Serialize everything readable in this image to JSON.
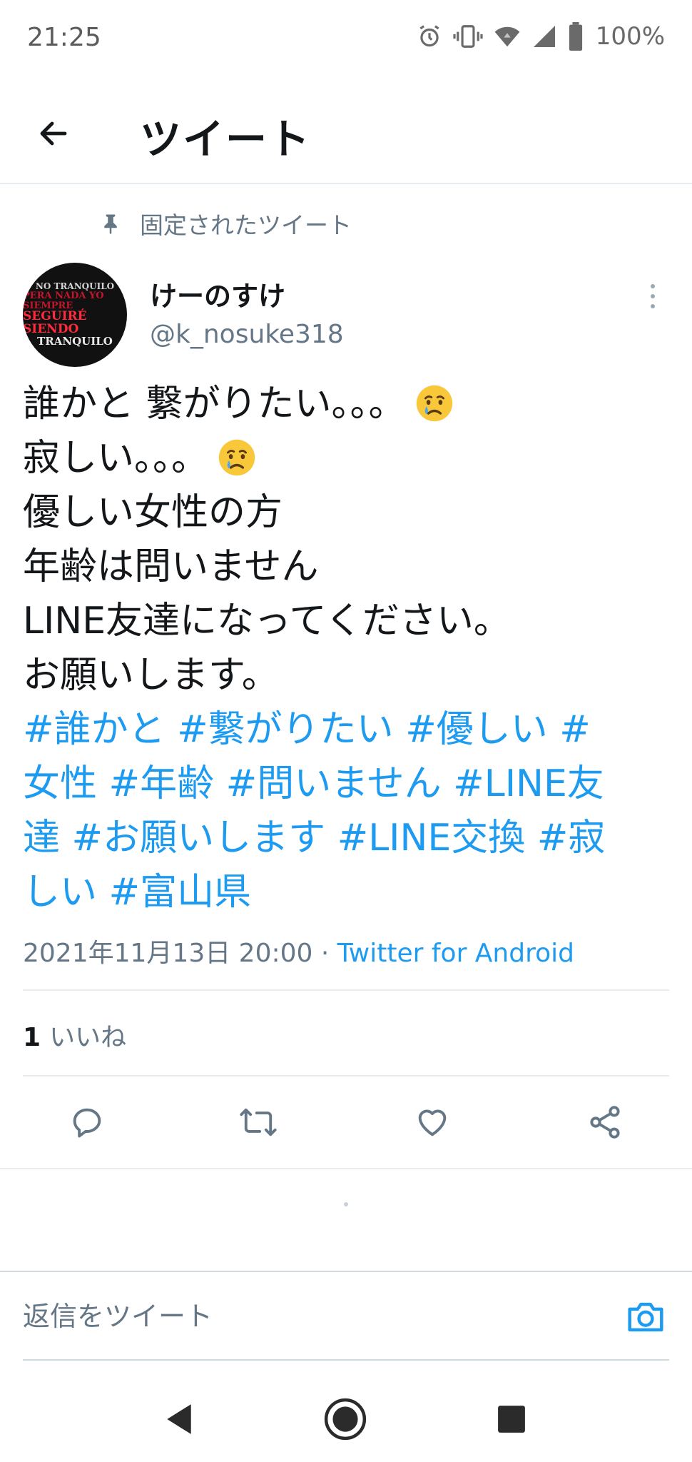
{
  "status_bar": {
    "time": "21:25",
    "battery": "100%",
    "icons": [
      "alarm-icon",
      "vibrate-icon",
      "wifi-icon",
      "signal-icon",
      "battery-icon"
    ]
  },
  "header": {
    "title": "ツイート",
    "back_icon": "back-arrow-icon"
  },
  "pinned": {
    "label": "固定されたツイート",
    "icon": "pin-icon"
  },
  "author": {
    "display_name": "けーのすけ",
    "handle": "@k_nosuke318",
    "avatar_text": [
      "NO TRANQUILO",
      "PERA NADA YO SIEMPRE",
      "SEGUIRÉ SIENDO",
      "TRANQUILO"
    ]
  },
  "tweet": {
    "lines": [
      "誰かと 繋がりたい。。。",
      "寂しい。。。",
      "優しい女性の方",
      "年齢は問いません",
      "LINE友達になってください。",
      "お願いします。"
    ],
    "hashtag_lines": [
      "#誰かと #繋がりたい #優しい #",
      "女性 #年齢 #問いません #LINE友",
      "達 #お願いします #LINE交換 #寂",
      "しい #富山県"
    ],
    "emoji": "crying-face-emoji"
  },
  "meta": {
    "timestamp": "2021年11月13日 20:00 ·",
    "source": "Twitter for Android"
  },
  "stats": {
    "likes_count": "1",
    "likes_label": "いいね"
  },
  "actions": [
    "reply-icon",
    "retweet-icon",
    "like-icon",
    "share-icon"
  ],
  "reply_bar": {
    "placeholder": "返信をツイート"
  },
  "colors": {
    "accent": "#1d9bf0",
    "secondary_text": "#657786",
    "primary_text": "#14171a"
  }
}
